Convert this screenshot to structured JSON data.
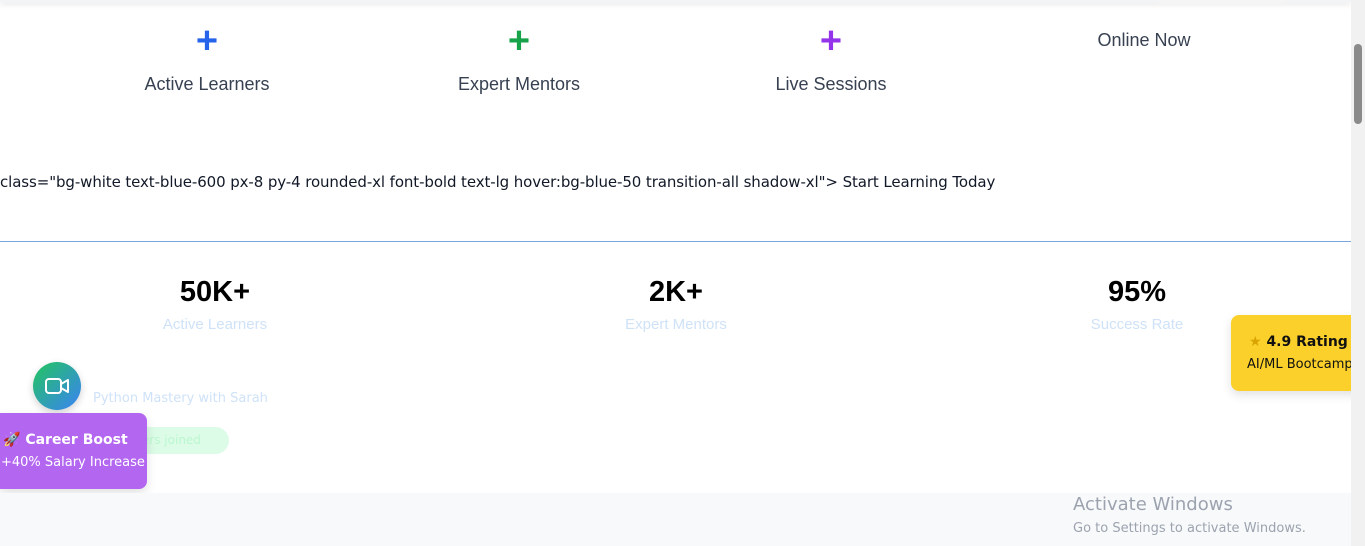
{
  "features": [
    {
      "label": "Active Learners",
      "icon": "plus-icon",
      "color": "#2563eb"
    },
    {
      "label": "Expert Mentors",
      "icon": "plus-icon",
      "color": "#16a34a"
    },
    {
      "label": "Live Sessions",
      "icon": "plus-icon",
      "color": "#9333ea"
    }
  ],
  "online_now": "Online Now",
  "raw_markup_text": "class=\"bg-white text-blue-600 px-8 py-4 rounded-xl font-bold text-lg hover:bg-blue-50 transition-all shadow-xl\"> Start Learning Today",
  "stats": [
    {
      "value": "50K+",
      "label": "Active Learners"
    },
    {
      "value": "2K+",
      "label": "Expert Mentors"
    },
    {
      "value": "95%",
      "label": "Success Rate"
    }
  ],
  "live_session": {
    "icon": "video-camera-icon",
    "title": "Python Mastery with Sarah",
    "joined": "users joined"
  },
  "career_card": {
    "icon": "rocket-icon",
    "title": "Career Boost",
    "subtitle": "+40% Salary Increase",
    "color": "#b366f0"
  },
  "rating_card": {
    "icon": "star-icon",
    "title": "4.9 Rating",
    "subtitle": "AI/ML Bootcamp",
    "color": "#fbd02b"
  },
  "windows_watermark": {
    "title": "Activate Windows",
    "subtitle": "Go to Settings to activate Windows."
  },
  "glyphs": {
    "plus": "+",
    "rocket": "🚀",
    "star": "★"
  }
}
